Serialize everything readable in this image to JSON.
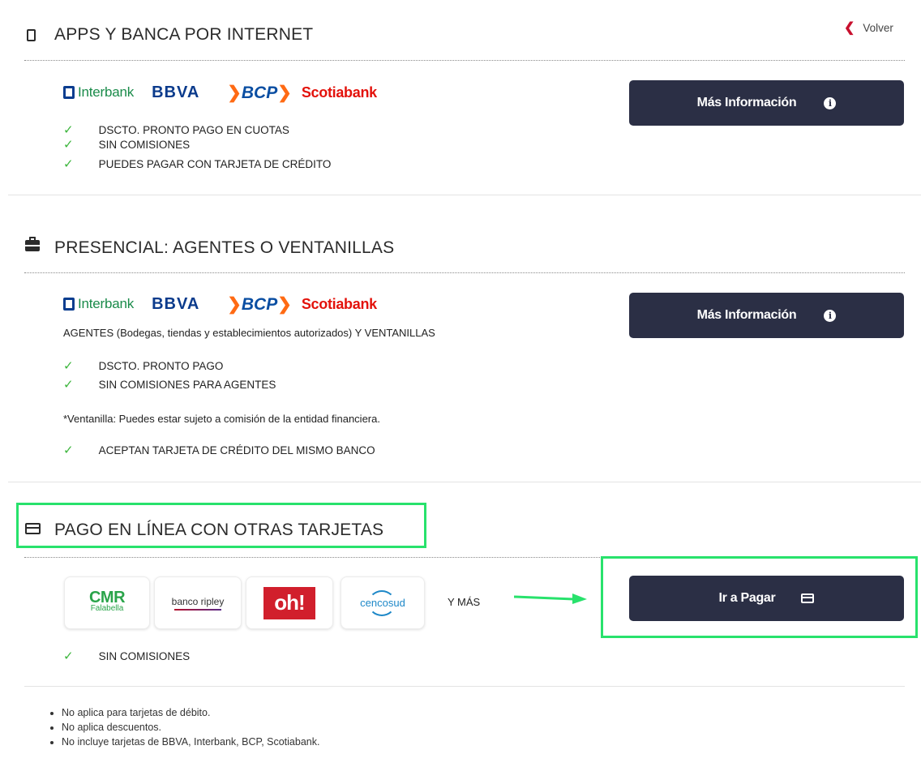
{
  "back": {
    "label": "Volver"
  },
  "section1": {
    "title": "APPS Y BANCA POR INTERNET",
    "banks": [
      "Interbank",
      "BBVA",
      "BCP",
      "Scotiabank"
    ],
    "checks": [
      "DSCTO. PRONTO PAGO EN CUOTAS",
      "SIN COMISIONES",
      "PUEDES PAGAR CON TARJETA DE CRÉDITO"
    ],
    "button_label": "Más Información"
  },
  "section2": {
    "title": "PRESENCIAL: AGENTES O VENTANILLAS",
    "banks": [
      "Interbank",
      "BBVA",
      "BCP",
      "Scotiabank"
    ],
    "agents_prefix": "AGENTES",
    "agents_middle": " (Bodegas, tiendas y establecimientos autorizados) ",
    "agents_suffix": "Y VENTANILLAS",
    "checks": [
      "DSCTO. PRONTO PAGO",
      "SIN COMISIONES PARA AGENTES"
    ],
    "note": "*Ventanilla: Puedes estar sujeto a comisión de la entidad financiera.",
    "check_extra": "ACEPTAN TARJETA DE CRÉDITO DEL MISMO BANCO",
    "button_label": "Más Información"
  },
  "section3": {
    "title": "PAGO EN LÍNEA CON OTRAS TARJETAS",
    "cards": {
      "cmr": "CMR",
      "cmr_sub": "Falabella",
      "ripley": "banco ripley",
      "oh": "oh!",
      "cencosud": "cencosud"
    },
    "more_label": "Y MÁS",
    "button_label": "Ir a Pagar",
    "checks": [
      "SIN COMISIONES"
    ],
    "notes": [
      "No aplica para tarjetas de débito.",
      "No aplica descuentos.",
      "No incluye tarjetas de BBVA, Interbank, BCP, Scotiabank."
    ]
  },
  "colors": {
    "button_bg": "#2b2f45",
    "check": "#3cb53c",
    "highlight": "#28e26c",
    "back_chevron": "#c8102e"
  }
}
